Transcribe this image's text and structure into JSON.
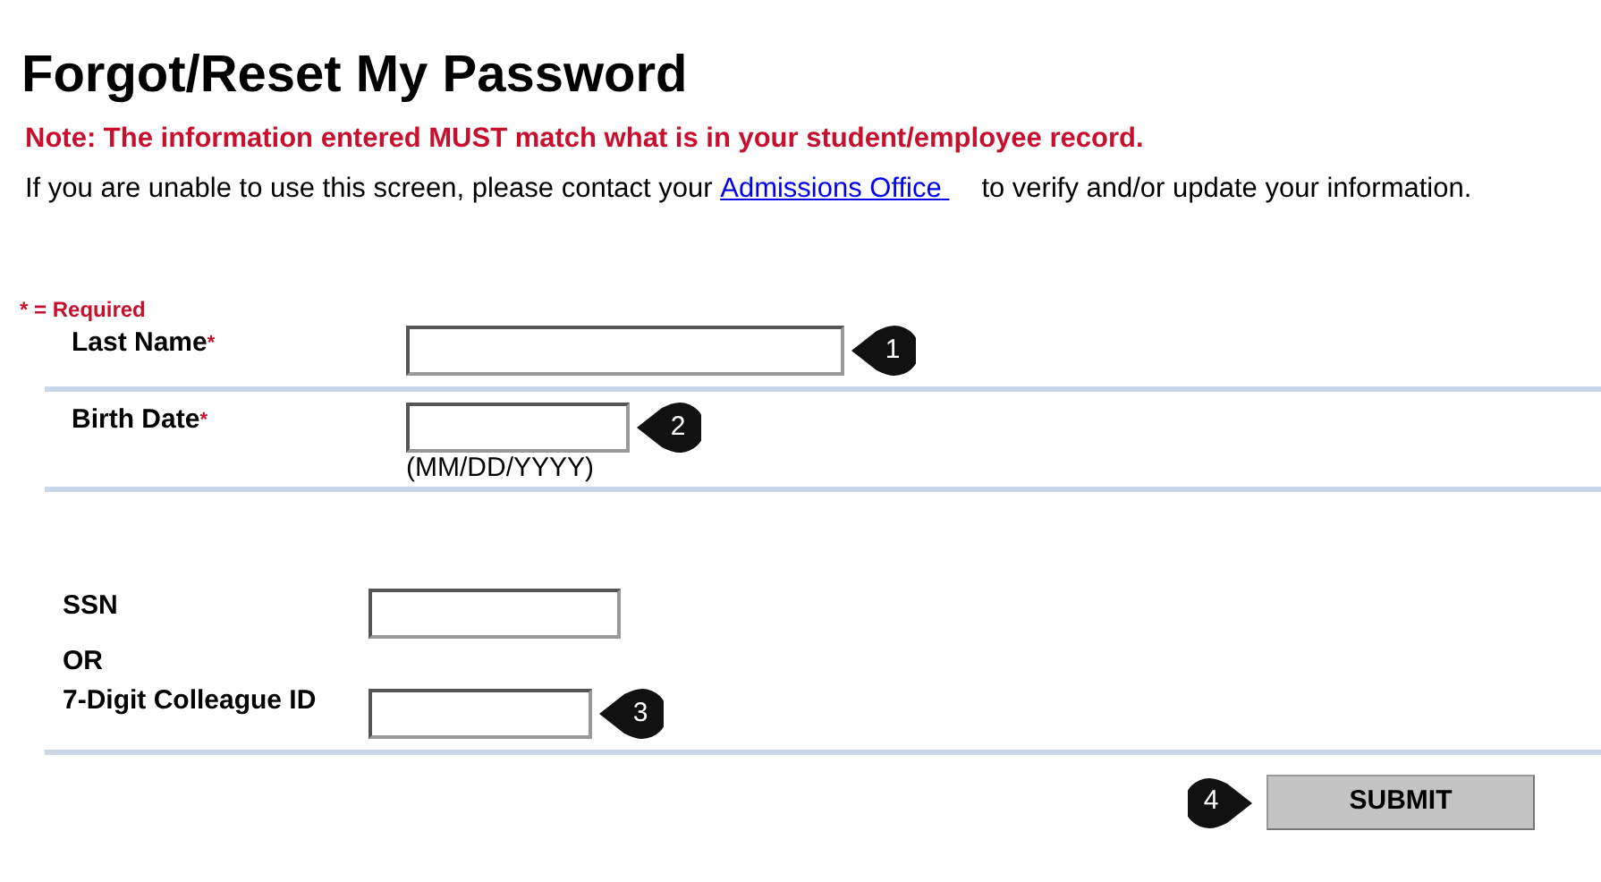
{
  "title": "Forgot/Reset My Password",
  "note": "Note: The information entered MUST match what is in your student/employee record.",
  "intro": {
    "before": "If you are unable to use this screen, please contact your",
    "link": "Admissions Office",
    "after": "to verify and/or update your information."
  },
  "required_legend": {
    "mark": "*",
    "text": "= Required"
  },
  "required_fields": [
    {
      "label": "Last Name",
      "required": true,
      "required_mark": "*",
      "callout": "1"
    },
    {
      "label": "Birth Date",
      "required": true,
      "required_mark": "*",
      "hint": "(MM/DD/YYYY)",
      "callout": "2"
    }
  ],
  "ssn": {
    "label": "SSN"
  },
  "or_text": "OR",
  "colleague_id": {
    "label": "7-Digit Colleague ID",
    "callout": "3"
  },
  "submit": {
    "label": "SUBMIT",
    "callout": "4"
  }
}
